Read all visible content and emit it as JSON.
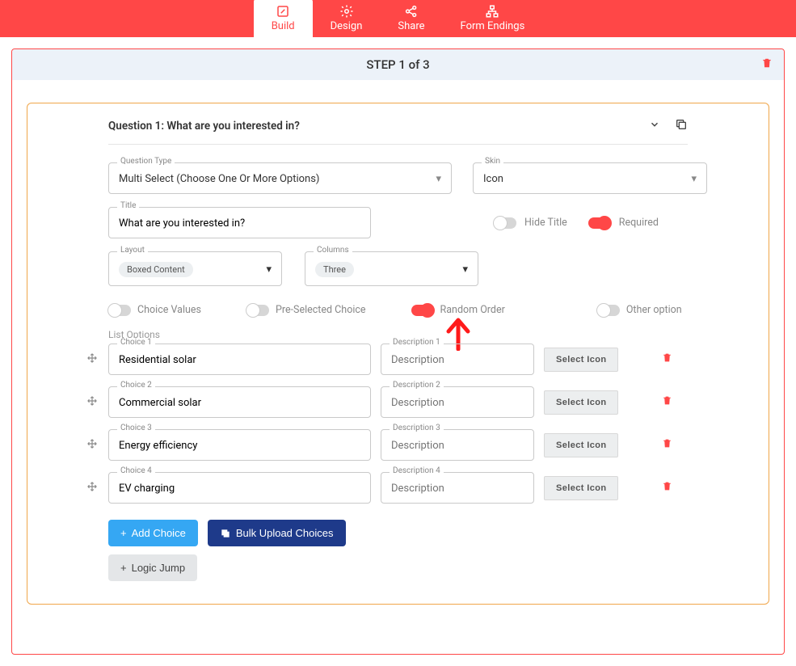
{
  "nav": {
    "tabs": [
      {
        "label": "Build"
      },
      {
        "label": "Design"
      },
      {
        "label": "Share"
      },
      {
        "label": "Form Endings"
      }
    ]
  },
  "step": {
    "title": "STEP 1 of 3"
  },
  "question": {
    "header": "Question 1: What are you interested in?",
    "question_type": {
      "label": "Question Type",
      "value": "Multi Select (Choose One Or More Options)"
    },
    "skin": {
      "label": "Skin",
      "value": "Icon"
    },
    "title_field": {
      "label": "Title",
      "value": "What are you interested in?"
    },
    "hide_title": {
      "label": "Hide Title",
      "on": false
    },
    "required": {
      "label": "Required",
      "on": true
    },
    "layout": {
      "label": "Layout",
      "value": "Boxed Content"
    },
    "columns": {
      "label": "Columns",
      "value": "Three"
    },
    "options": {
      "choice_values": {
        "label": "Choice Values",
        "on": false
      },
      "preselected": {
        "label": "Pre-Selected Choice",
        "on": false
      },
      "random_order": {
        "label": "Random Order",
        "on": true
      },
      "other_option": {
        "label": "Other option",
        "on": false
      }
    },
    "list_label": "List Options",
    "choices": [
      {
        "choice_label": "Choice 1",
        "value": "Residential solar",
        "desc_label": "Description 1",
        "desc_placeholder": "Description"
      },
      {
        "choice_label": "Choice 2",
        "value": "Commercial solar",
        "desc_label": "Description 2",
        "desc_placeholder": "Description"
      },
      {
        "choice_label": "Choice 3",
        "value": "Energy efficiency",
        "desc_label": "Description 3",
        "desc_placeholder": "Description"
      },
      {
        "choice_label": "Choice 4",
        "value": "EV charging",
        "desc_label": "Description 4",
        "desc_placeholder": "Description"
      }
    ],
    "select_icon_label": "Select Icon",
    "buttons": {
      "add_choice": "Add Choice",
      "bulk_upload": "Bulk Upload Choices",
      "logic_jump": "Logic Jump"
    }
  },
  "colors": {
    "accent": "#ff4747"
  }
}
